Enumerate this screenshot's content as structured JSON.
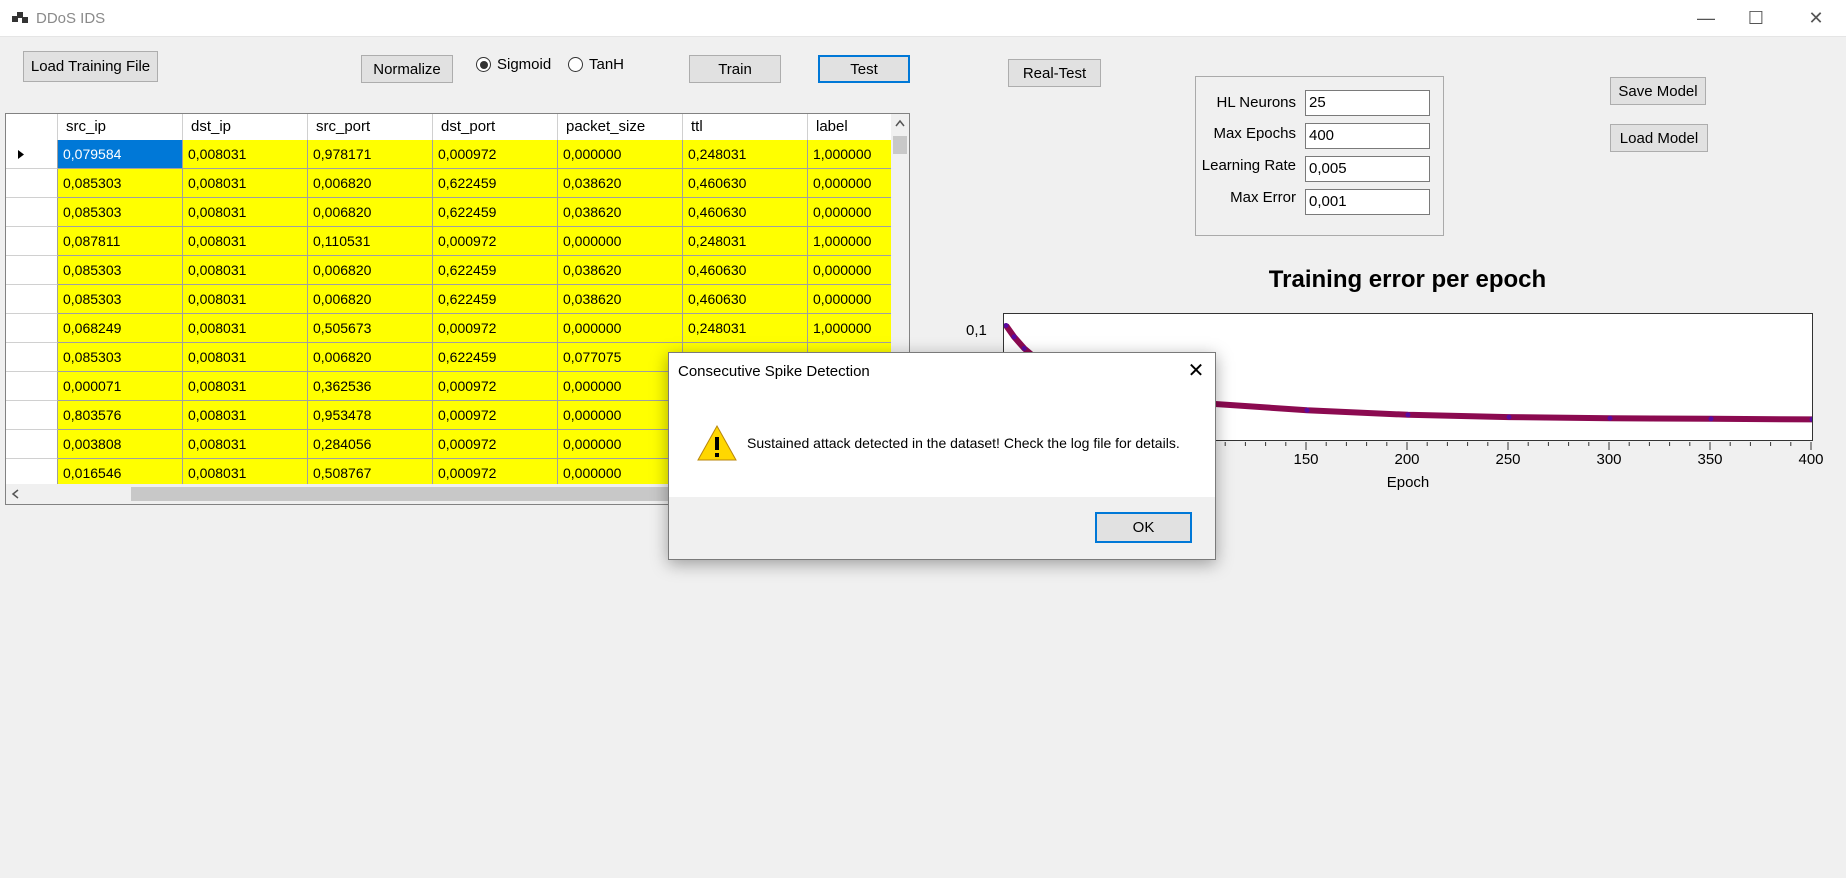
{
  "window": {
    "title": "DDoS IDS",
    "controls": {
      "minimize": "—",
      "maximize": "☐",
      "close": "✕"
    }
  },
  "toolbar": {
    "load_training_file": "Load Training File",
    "normalize": "Normalize",
    "activation_options": [
      {
        "label": "Sigmoid",
        "selected": true
      },
      {
        "label": "TanH",
        "selected": false
      }
    ],
    "train": "Train",
    "test": "Test",
    "real_test": "Real-Test",
    "save_model": "Save Model",
    "load_model": "Load Model"
  },
  "params": {
    "hl_neurons_label": "HL Neurons",
    "hl_neurons_value": "25",
    "max_epochs_label": "Max Epochs",
    "max_epochs_value": "400",
    "learning_rate_label": "Learning Rate",
    "learning_rate_value": "0,005",
    "max_error_label": "Max Error",
    "max_error_value": "0,001"
  },
  "grid": {
    "columns": [
      "src_ip",
      "dst_ip",
      "src_port",
      "dst_port",
      "packet_size",
      "ttl",
      "label"
    ],
    "rows": [
      [
        "0,079584",
        "0,008031",
        "0,978171",
        "0,000972",
        "0,000000",
        "0,248031",
        "1,000000"
      ],
      [
        "0,085303",
        "0,008031",
        "0,006820",
        "0,622459",
        "0,038620",
        "0,460630",
        "0,000000"
      ],
      [
        "0,085303",
        "0,008031",
        "0,006820",
        "0,622459",
        "0,038620",
        "0,460630",
        "0,000000"
      ],
      [
        "0,087811",
        "0,008031",
        "0,110531",
        "0,000972",
        "0,000000",
        "0,248031",
        "1,000000"
      ],
      [
        "0,085303",
        "0,008031",
        "0,006820",
        "0,622459",
        "0,038620",
        "0,460630",
        "0,000000"
      ],
      [
        "0,085303",
        "0,008031",
        "0,006820",
        "0,622459",
        "0,038620",
        "0,460630",
        "0,000000"
      ],
      [
        "0,068249",
        "0,008031",
        "0,505673",
        "0,000972",
        "0,000000",
        "0,248031",
        "1,000000"
      ],
      [
        "0,085303",
        "0,008031",
        "0,006820",
        "0,622459",
        "0,077075",
        "",
        ""
      ],
      [
        "0,000071",
        "0,008031",
        "0,362536",
        "0,000972",
        "0,000000",
        "",
        ""
      ],
      [
        "0,803576",
        "0,008031",
        "0,953478",
        "0,000972",
        "0,000000",
        "",
        ""
      ],
      [
        "0,003808",
        "0,008031",
        "0,284056",
        "0,000972",
        "0,000000",
        "",
        ""
      ],
      [
        "0,016546",
        "0,008031",
        "0,508767",
        "0,000972",
        "0,000000",
        "",
        ""
      ]
    ]
  },
  "chart": {
    "title": "Training error per epoch",
    "xlabel": "Epoch",
    "y_tick": "0,1",
    "x_ticks": [
      "150",
      "200",
      "250",
      "300",
      "350",
      "400"
    ],
    "line_color": "#8b0a50",
    "marker_color": "#5a0aa0"
  },
  "chart_data": {
    "type": "line",
    "title": "Training error per epoch",
    "xlabel": "Epoch",
    "ylabel": "",
    "xlim": [
      0,
      400
    ],
    "ylim": [
      0,
      0.11
    ],
    "x": [
      1,
      5,
      10,
      20,
      40,
      60,
      80,
      100,
      150,
      200,
      250,
      300,
      350,
      400
    ],
    "y": [
      0.1,
      0.09,
      0.08,
      0.065,
      0.05,
      0.042,
      0.036,
      0.032,
      0.026,
      0.022,
      0.02,
      0.019,
      0.0185,
      0.018
    ]
  },
  "dialog": {
    "title": "Consecutive Spike Detection",
    "message": "Sustained attack detected in the dataset! Check the log file for details.",
    "ok": "OK",
    "icon": "warning-icon"
  }
}
